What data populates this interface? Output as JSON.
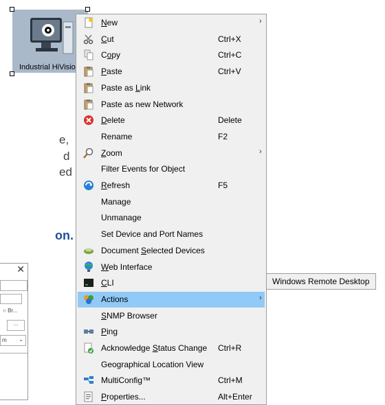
{
  "device": {
    "label": "Industrial HiVision"
  },
  "background": {
    "fragments": [
      "e,",
      "d",
      "ed"
    ],
    "bold_fragment": "on.",
    "dialog_close": "✕",
    "dialog_radio": "Br...",
    "dialog_browse": "...",
    "dialog_select": "m"
  },
  "menu": {
    "items": [
      {
        "pre": "",
        "u": "N",
        "post": "ew",
        "shortcut": "",
        "arrow": "›",
        "icon": "new-icon"
      },
      {
        "pre": "",
        "u": "C",
        "post": "ut",
        "shortcut": "Ctrl+X",
        "arrow": "",
        "icon": "cut-icon"
      },
      {
        "pre": "C",
        "u": "o",
        "post": "py",
        "shortcut": "Ctrl+C",
        "arrow": "",
        "icon": "copy-icon"
      },
      {
        "pre": "",
        "u": "P",
        "post": "aste",
        "shortcut": "Ctrl+V",
        "arrow": "",
        "icon": "paste-icon"
      },
      {
        "pre": "Paste as ",
        "u": "L",
        "post": "ink",
        "shortcut": "",
        "arrow": "",
        "icon": "paste-link-icon"
      },
      {
        "pre": "Paste as new Network",
        "u": "",
        "post": "",
        "shortcut": "",
        "arrow": "",
        "icon": "paste-network-icon"
      },
      {
        "pre": "",
        "u": "D",
        "post": "elete",
        "shortcut": "Delete",
        "arrow": "",
        "icon": "delete-icon"
      },
      {
        "pre": "Rename",
        "u": "",
        "post": "",
        "shortcut": "F2",
        "arrow": "",
        "icon": ""
      },
      {
        "pre": "",
        "u": "Z",
        "post": "oom",
        "shortcut": "",
        "arrow": "›",
        "icon": "zoom-icon"
      },
      {
        "pre": "Filter Events for Object",
        "u": "",
        "post": "",
        "shortcut": "",
        "arrow": "",
        "icon": ""
      },
      {
        "pre": "",
        "u": "R",
        "post": "efresh",
        "shortcut": "F5",
        "arrow": "",
        "icon": "refresh-icon"
      },
      {
        "pre": "Manage",
        "u": "",
        "post": "",
        "shortcut": "",
        "arrow": "",
        "icon": ""
      },
      {
        "pre": "Unmanage",
        "u": "",
        "post": "",
        "shortcut": "",
        "arrow": "",
        "icon": ""
      },
      {
        "pre": "Set Device and Port Names",
        "u": "",
        "post": "",
        "shortcut": "",
        "arrow": "",
        "icon": ""
      },
      {
        "pre": "Document ",
        "u": "S",
        "post": "elected Devices",
        "shortcut": "",
        "arrow": "",
        "icon": "document-icon"
      },
      {
        "pre": "",
        "u": "W",
        "post": "eb Interface",
        "shortcut": "",
        "arrow": "",
        "icon": "web-icon"
      },
      {
        "pre": "",
        "u": "C",
        "post": "LI",
        "shortcut": "",
        "arrow": "",
        "icon": "cli-icon"
      },
      {
        "pre": "Actions",
        "u": "",
        "post": "",
        "shortcut": "",
        "arrow": "›",
        "icon": "actions-icon"
      },
      {
        "pre": "",
        "u": "S",
        "post": "NMP Browser",
        "shortcut": "",
        "arrow": "",
        "icon": ""
      },
      {
        "pre": "",
        "u": "P",
        "post": "ing",
        "shortcut": "",
        "arrow": "",
        "icon": "ping-icon"
      },
      {
        "pre": "Acknowledge ",
        "u": "S",
        "post": "tatus Change",
        "shortcut": "Ctrl+R",
        "arrow": "",
        "icon": "acknowledge-icon"
      },
      {
        "pre": "Geographical Location View",
        "u": "",
        "post": "",
        "shortcut": "",
        "arrow": "",
        "icon": ""
      },
      {
        "pre": "MultiConfig™",
        "u": "",
        "post": "",
        "shortcut": "Ctrl+M",
        "arrow": "",
        "icon": "multiconfig-icon"
      },
      {
        "pre": "",
        "u": "P",
        "post": "roperties...",
        "shortcut": "Alt+Enter",
        "arrow": "",
        "icon": "properties-icon"
      }
    ],
    "highlighted": 17
  },
  "submenu": {
    "label": "Windows Remote Desktop"
  },
  "colors": {
    "highlight": "#91c9f7",
    "menu_bg": "#f0f0f0",
    "link_blue": "#1f4e9a"
  }
}
